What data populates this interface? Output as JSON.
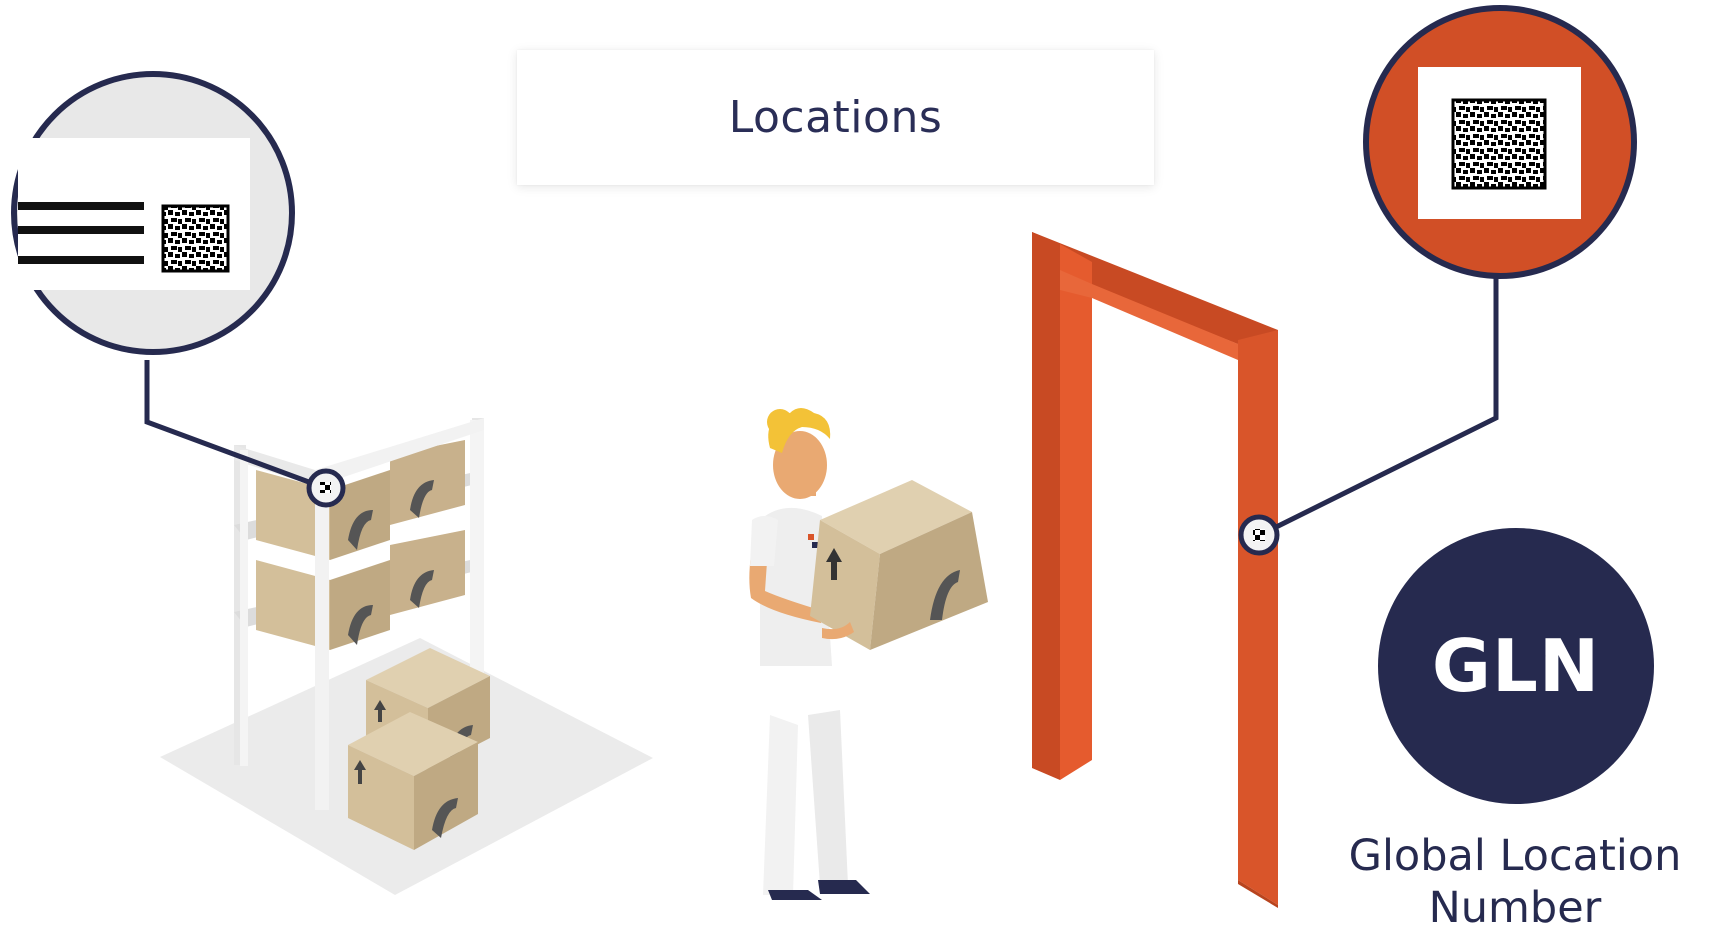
{
  "title": "Locations",
  "badge": {
    "label": "GLN",
    "caption_line1": "Global Location",
    "caption_line2": "Number"
  },
  "colors": {
    "navy": "#262a4f",
    "orange": "#d9552a",
    "box": "#d6c3a0",
    "shelf": "#eeeeee"
  },
  "icons": [
    "datamatrix-barcode-icon",
    "up-arrow-icon",
    "logo-icon"
  ]
}
